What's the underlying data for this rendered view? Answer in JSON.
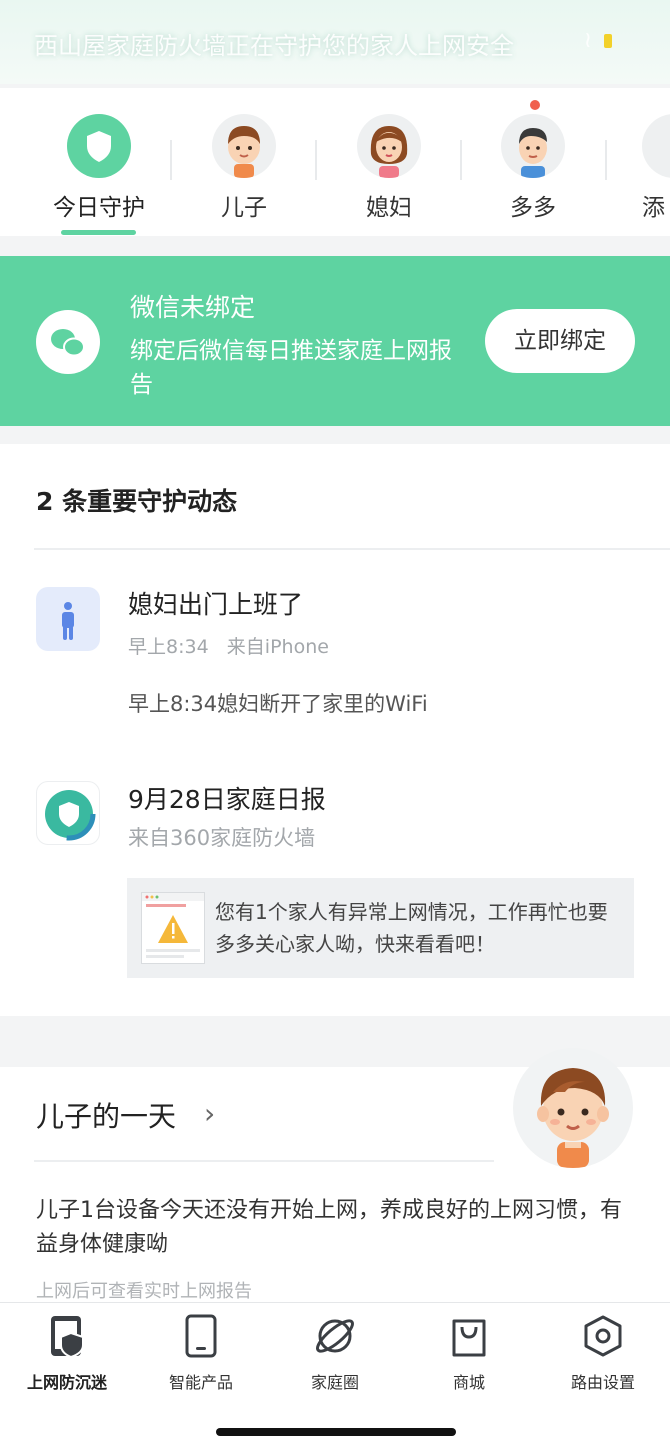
{
  "status_bar": {
    "notification_text": "西山屋家庭防火墙正在守护您的家人上网安全"
  },
  "profiles": [
    {
      "label": "今日守护",
      "icon": "shield-icon",
      "active": true
    },
    {
      "label": "儿子",
      "icon": "boy-avatar",
      "active": false
    },
    {
      "label": "媳妇",
      "icon": "woman-avatar",
      "active": false
    },
    {
      "label": "多多",
      "icon": "man-avatar",
      "active": false
    },
    {
      "label": "添",
      "icon": "add-avatar",
      "active": false
    }
  ],
  "wechat_banner": {
    "title": "微信未绑定",
    "description": "绑定后微信每日推送家庭上网报告",
    "button_label": "立即绑定"
  },
  "events": {
    "heading": "2 条重要守护动态",
    "items": [
      {
        "title": "媳妇出门上班了",
        "time": "早上8:34",
        "source": "来自iPhone",
        "body": "早上8:34媳妇断开了家里的WiFi",
        "icon": "person-walking-icon"
      },
      {
        "title": "9月28日家庭日报",
        "source": "来自360家庭防火墙",
        "report_text": "您有1个家人有异常上网情况，工作再忙也要多多关心家人呦，快来看看吧！",
        "icon": "firewall-shield-icon"
      }
    ]
  },
  "son_day": {
    "title": "儿子的一天",
    "description": "儿子1台设备今天还没有开始上网，养成良好的上网习惯，有益身体健康呦",
    "note": "上网后可查看实时上网报告"
  },
  "bottom_nav": [
    {
      "label": "上网防沉迷",
      "icon": "phone-shield-icon",
      "active": true
    },
    {
      "label": "智能产品",
      "icon": "device-icon",
      "active": false
    },
    {
      "label": "家庭圈",
      "icon": "planet-icon",
      "active": false
    },
    {
      "label": "商城",
      "icon": "shopping-bag-icon",
      "active": false
    },
    {
      "label": "路由设置",
      "icon": "hex-gear-icon",
      "active": false
    }
  ],
  "colors": {
    "accent": "#5ed3a1",
    "badge": "#f0604d"
  }
}
